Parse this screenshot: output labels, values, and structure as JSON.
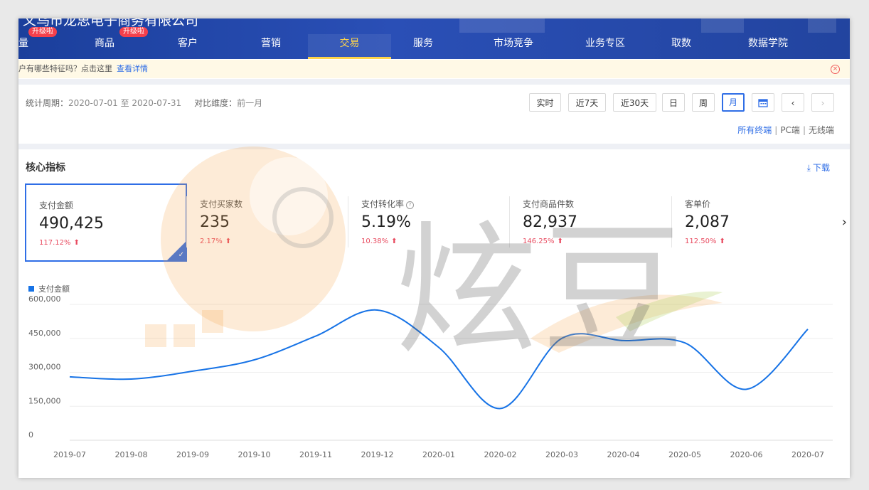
{
  "header": {
    "company": "义乌市龙思电子商务有限公司",
    "nav": [
      {
        "label": "量",
        "badge": "升级啦"
      },
      {
        "label": "商品",
        "badge": "升级啦"
      },
      {
        "label": "客户"
      },
      {
        "label": "营销"
      },
      {
        "label": "交易"
      },
      {
        "label": "服务"
      },
      {
        "label": "市场竞争"
      },
      {
        "label": "业务专区"
      },
      {
        "label": "取数"
      },
      {
        "label": "数据学院"
      }
    ],
    "active_tab": "交易"
  },
  "notice": {
    "text": "户有哪些特征吗？点击这里",
    "link": "查看详情"
  },
  "filters": {
    "period_label": "统计周期：",
    "period_value": "2020-07-01 至 2020-07-31",
    "compare_label": "对比维度：",
    "compare_value": "前一月",
    "buttons": [
      "实时",
      "近7天",
      "近30天",
      "日",
      "周",
      "月"
    ],
    "active_button": "月",
    "terminals": [
      "所有终端",
      "PC端",
      "无线端"
    ],
    "active_terminal": "所有终端"
  },
  "core": {
    "title": "核心指标",
    "download": "下载",
    "metrics": [
      {
        "label": "支付金额",
        "value": "490,425",
        "change": "117.12%",
        "selected": true
      },
      {
        "label": "支付买家数",
        "value": "235",
        "change": "2.17%"
      },
      {
        "label": "支付转化率",
        "value": "5.19%",
        "change": "10.38%",
        "info": true
      },
      {
        "label": "支付商品件数",
        "value": "82,937",
        "change": "146.25%"
      },
      {
        "label": "客单价",
        "value": "2,087",
        "change": "112.50%"
      }
    ]
  },
  "chart_data": {
    "type": "line",
    "x": [
      "2019-07",
      "2019-08",
      "2019-09",
      "2019-10",
      "2019-11",
      "2019-12",
      "2020-01",
      "2020-02",
      "2020-03",
      "2020-04",
      "2020-05",
      "2020-06",
      "2020-07"
    ],
    "series": [
      {
        "name": "支付金额",
        "color": "#1773e6",
        "values": [
          280000,
          270000,
          305000,
          355000,
          460000,
          575000,
          410000,
          140000,
          450000,
          440000,
          430000,
          225000,
          490425
        ]
      }
    ],
    "yticks": [
      "600,000",
      "450,000",
      "300,000",
      "150,000",
      "0"
    ],
    "ylim": [
      0,
      600000
    ],
    "grid": true,
    "legend": "top-left"
  },
  "watermark": {
    "text": "炫豆"
  },
  "colors": {
    "accent": "#2f6ee6",
    "nav_bg": "#22449f",
    "nav_active": "#ffd54a",
    "up": "#e84a5f",
    "line": "#1773e6"
  }
}
